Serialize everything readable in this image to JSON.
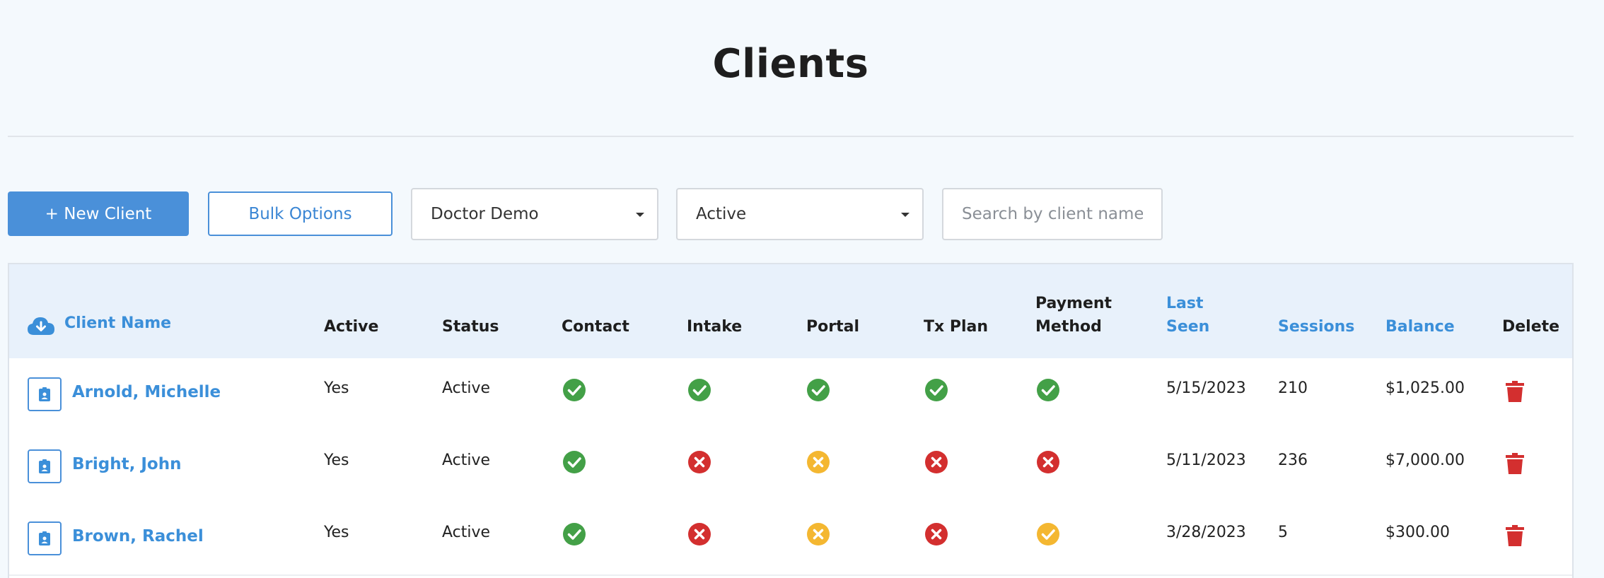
{
  "page": {
    "title": "Clients"
  },
  "toolbar": {
    "new_client_label": "+ New Client",
    "bulk_options_label": "Bulk Options",
    "doctor_select_value": "Doctor Demo",
    "status_select_value": "Active",
    "search_placeholder": "Search by client name"
  },
  "table": {
    "headers": {
      "client_name": "Client Name",
      "active": "Active",
      "status": "Status",
      "contact": "Contact",
      "intake": "Intake",
      "portal": "Portal",
      "tx_plan": "Tx Plan",
      "payment_method_line1": "Payment",
      "payment_method_line2": "Method",
      "last_seen_line1": "Last",
      "last_seen_line2": "Seen",
      "sessions": "Sessions",
      "balance": "Balance",
      "delete": "Delete"
    },
    "rows": [
      {
        "name": "Arnold, Michelle",
        "active": "Yes",
        "status": "Active",
        "contact": "check",
        "intake": "check",
        "portal": "check",
        "tx_plan": "check",
        "payment_method": "check",
        "last_seen": "5/15/2023",
        "sessions": "210",
        "balance": "$1,025.00"
      },
      {
        "name": "Bright, John",
        "active": "Yes",
        "status": "Active",
        "contact": "check",
        "intake": "cross",
        "portal": "warning-cross",
        "tx_plan": "cross",
        "payment_method": "cross",
        "last_seen": "5/11/2023",
        "sessions": "236",
        "balance": "$7,000.00"
      },
      {
        "name": "Brown, Rachel",
        "active": "Yes",
        "status": "Active",
        "contact": "check",
        "intake": "cross",
        "portal": "warning-cross",
        "tx_plan": "cross",
        "payment_method": "warning-check",
        "last_seen": "3/28/2023",
        "sessions": "5",
        "balance": "$300.00"
      }
    ]
  },
  "icons": {
    "header_download": "cloud-download-icon",
    "row_avatar": "id-badge-icon",
    "delete": "trash-icon",
    "status_check": "check-circle-icon",
    "status_cross": "x-circle-icon",
    "status_warning_cross": "warning-x-circle-icon",
    "status_warning_check": "warning-check-circle-icon"
  },
  "colors": {
    "accent": "#4a90d9",
    "link": "#3b8fd9",
    "success": "#43a047",
    "danger": "#d32f2f",
    "warning": "#f4b731",
    "header_bg": "#e8f1fb",
    "page_bg": "#f4f9fd"
  }
}
